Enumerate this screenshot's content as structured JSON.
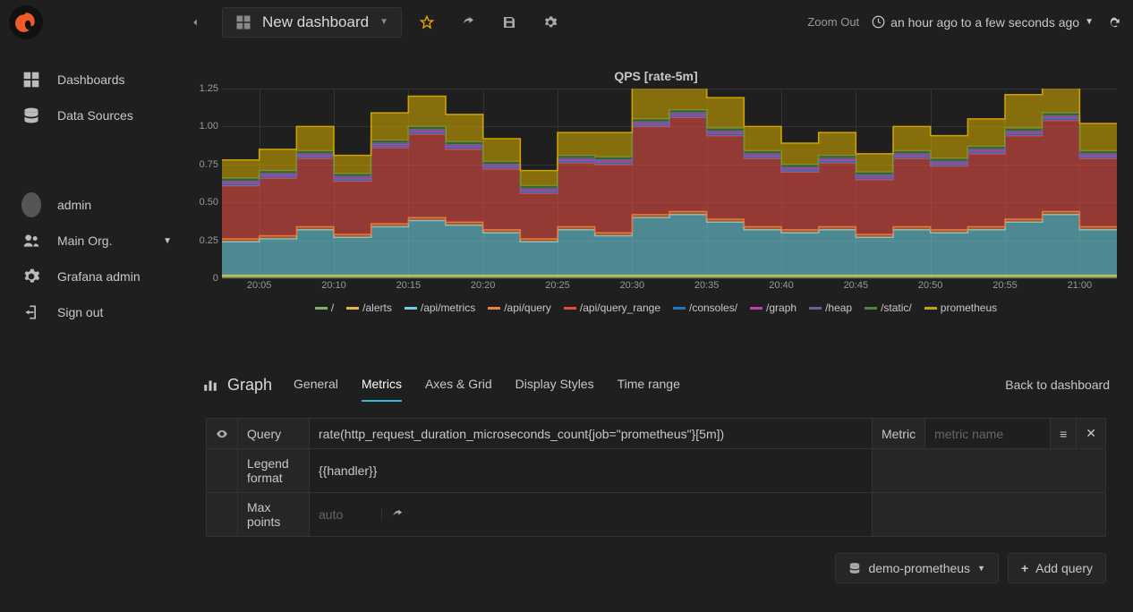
{
  "topbar": {
    "dashboard_title": "New dashboard",
    "zoom_out": "Zoom Out",
    "time_label": "an hour ago to a few seconds ago"
  },
  "sidebar": {
    "items": [
      {
        "icon": "dashboard",
        "label": "Dashboards"
      },
      {
        "icon": "database",
        "label": "Data Sources"
      }
    ],
    "user_items": [
      {
        "icon": "avatar",
        "label": "admin"
      },
      {
        "icon": "users",
        "label": "Main Org.",
        "caret": true
      },
      {
        "icon": "gear",
        "label": "Grafana admin"
      },
      {
        "icon": "signout",
        "label": "Sign out"
      }
    ]
  },
  "chart_data": {
    "type": "area",
    "title": "QPS [rate-5m]",
    "ylabel": "",
    "ylim": [
      0,
      1.25
    ],
    "yticks": [
      0,
      0.25,
      0.5,
      0.75,
      1.0,
      1.25
    ],
    "xticks": [
      "20:05",
      "20:10",
      "20:15",
      "20:20",
      "20:25",
      "20:30",
      "20:35",
      "20:40",
      "20:45",
      "20:50",
      "20:55",
      "21:00"
    ],
    "x": [
      0,
      1,
      2,
      3,
      4,
      5,
      6,
      7,
      8,
      9,
      10,
      11,
      12,
      13,
      14,
      15,
      16,
      17,
      18,
      19,
      20,
      21,
      22,
      23
    ],
    "series": [
      {
        "name": "/",
        "color": "#7eb26d",
        "values": [
          0.01,
          0.01,
          0.01,
          0.01,
          0.01,
          0.01,
          0.01,
          0.01,
          0.01,
          0.01,
          0.01,
          0.01,
          0.01,
          0.01,
          0.01,
          0.01,
          0.01,
          0.01,
          0.01,
          0.01,
          0.01,
          0.01,
          0.01,
          0.01
        ]
      },
      {
        "name": "/alerts",
        "color": "#eab839",
        "values": [
          0.01,
          0.01,
          0.01,
          0.01,
          0.01,
          0.01,
          0.01,
          0.01,
          0.01,
          0.01,
          0.01,
          0.01,
          0.01,
          0.01,
          0.01,
          0.01,
          0.01,
          0.01,
          0.01,
          0.01,
          0.01,
          0.01,
          0.01,
          0.01
        ]
      },
      {
        "name": "/api/metrics",
        "color": "#6ed0e0",
        "values": [
          0.22,
          0.24,
          0.3,
          0.25,
          0.32,
          0.36,
          0.33,
          0.28,
          0.22,
          0.3,
          0.26,
          0.38,
          0.4,
          0.35,
          0.3,
          0.28,
          0.3,
          0.25,
          0.3,
          0.28,
          0.3,
          0.35,
          0.4,
          0.3
        ]
      },
      {
        "name": "/api/query",
        "color": "#ef843c",
        "values": [
          0.02,
          0.02,
          0.02,
          0.02,
          0.02,
          0.02,
          0.02,
          0.02,
          0.02,
          0.02,
          0.02,
          0.02,
          0.02,
          0.02,
          0.02,
          0.02,
          0.02,
          0.02,
          0.02,
          0.02,
          0.02,
          0.02,
          0.02,
          0.02
        ]
      },
      {
        "name": "/api/query_range",
        "color": "#e24d42",
        "values": [
          0.35,
          0.38,
          0.45,
          0.35,
          0.5,
          0.55,
          0.48,
          0.4,
          0.3,
          0.42,
          0.45,
          0.58,
          0.62,
          0.55,
          0.45,
          0.38,
          0.42,
          0.36,
          0.45,
          0.42,
          0.48,
          0.55,
          0.6,
          0.45
        ]
      },
      {
        "name": "/consoles/",
        "color": "#1f78c1",
        "values": [
          0.01,
          0.01,
          0.01,
          0.01,
          0.01,
          0.01,
          0.01,
          0.01,
          0.01,
          0.01,
          0.01,
          0.01,
          0.01,
          0.01,
          0.01,
          0.01,
          0.01,
          0.01,
          0.01,
          0.01,
          0.01,
          0.01,
          0.01,
          0.01
        ]
      },
      {
        "name": "/graph",
        "color": "#ba43a9",
        "values": [
          0.01,
          0.01,
          0.01,
          0.01,
          0.01,
          0.01,
          0.01,
          0.01,
          0.01,
          0.01,
          0.01,
          0.01,
          0.01,
          0.01,
          0.01,
          0.01,
          0.01,
          0.01,
          0.01,
          0.01,
          0.01,
          0.01,
          0.01,
          0.01
        ]
      },
      {
        "name": "/heap",
        "color": "#705da0",
        "values": [
          0.01,
          0.01,
          0.01,
          0.01,
          0.01,
          0.01,
          0.01,
          0.01,
          0.01,
          0.01,
          0.01,
          0.01,
          0.01,
          0.01,
          0.01,
          0.01,
          0.01,
          0.01,
          0.01,
          0.01,
          0.01,
          0.01,
          0.01,
          0.01
        ]
      },
      {
        "name": "/static/",
        "color": "#508642",
        "values": [
          0.02,
          0.02,
          0.02,
          0.02,
          0.02,
          0.02,
          0.02,
          0.02,
          0.02,
          0.02,
          0.02,
          0.02,
          0.02,
          0.02,
          0.02,
          0.02,
          0.02,
          0.02,
          0.02,
          0.02,
          0.02,
          0.02,
          0.02,
          0.02
        ]
      },
      {
        "name": "prometheus",
        "color": "#cca300",
        "values": [
          0.12,
          0.14,
          0.16,
          0.12,
          0.18,
          0.2,
          0.18,
          0.15,
          0.1,
          0.15,
          0.16,
          0.22,
          0.25,
          0.2,
          0.16,
          0.14,
          0.15,
          0.12,
          0.16,
          0.15,
          0.18,
          0.22,
          0.25,
          0.18
        ]
      }
    ]
  },
  "editor": {
    "type_label": "Graph",
    "tabs": [
      "General",
      "Metrics",
      "Axes & Grid",
      "Display Styles",
      "Time range"
    ],
    "active_tab": "Metrics",
    "back": "Back to dashboard",
    "query": {
      "query_label": "Query",
      "query_value": "rate(http_request_duration_microseconds_count{job=\"prometheus\"}[5m])",
      "metric_label": "Metric",
      "metric_placeholder": "metric name",
      "legend_label": "Legend format",
      "legend_value": "{{handler}}",
      "maxpoints_label": "Max points",
      "maxpoints_placeholder": "auto"
    },
    "datasource": "demo-prometheus",
    "add_query": "Add query"
  }
}
